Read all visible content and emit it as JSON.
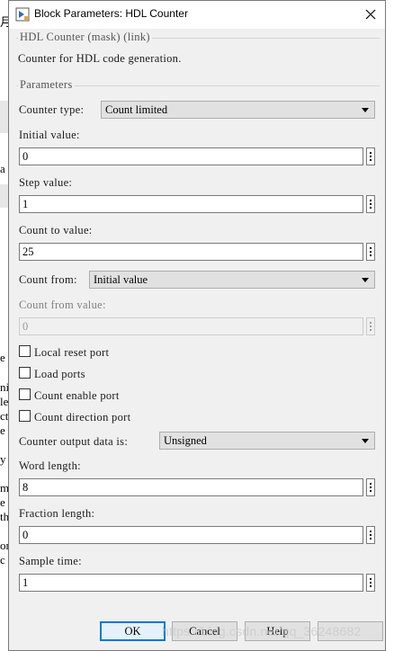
{
  "window": {
    "title": "Block Parameters: HDL Counter",
    "close_glyph": "✕"
  },
  "header": {
    "mask_label": "HDL Counter (mask) (link)",
    "description": "Counter for HDL code generation."
  },
  "parameters": {
    "group_label": "Parameters",
    "counter_type": {
      "label": "Counter type:",
      "value": "Count limited"
    },
    "initial_value": {
      "label": "Initial value:",
      "value": "0"
    },
    "step_value": {
      "label": "Step value:",
      "value": "1"
    },
    "count_to_value": {
      "label": "Count to value:",
      "value": "25"
    },
    "count_from": {
      "label": "Count from:",
      "value": "Initial value"
    },
    "count_from_value": {
      "label": "Count from value:",
      "value": "0",
      "enabled": false
    },
    "checkboxes": [
      {
        "label": "Local reset port",
        "checked": false
      },
      {
        "label": "Load ports",
        "checked": false
      },
      {
        "label": "Count enable port",
        "checked": false
      },
      {
        "label": "Count direction port",
        "checked": false
      }
    ],
    "output_data_type": {
      "label": "Counter output data is:",
      "value": "Unsigned"
    },
    "word_length": {
      "label": "Word length:",
      "value": "8"
    },
    "fraction_length": {
      "label": "Fraction length:",
      "value": "0"
    },
    "sample_time": {
      "label": "Sample time:",
      "value": "1"
    }
  },
  "buttons": {
    "ok": "OK",
    "cancel": "Cancel",
    "help": "Help"
  },
  "watermark": "https://blog.csdn.net/qq_36248682",
  "background_glyphs": [
    "月",
    "a",
    "e",
    "ni",
    "le",
    "ct",
    "e",
    "y",
    "m",
    "e",
    "th",
    "or",
    "c"
  ],
  "colors": {
    "dialog_bg": "#f0f0f0",
    "default_button_border": "#0078d7",
    "title_bar": "#ffffff"
  }
}
